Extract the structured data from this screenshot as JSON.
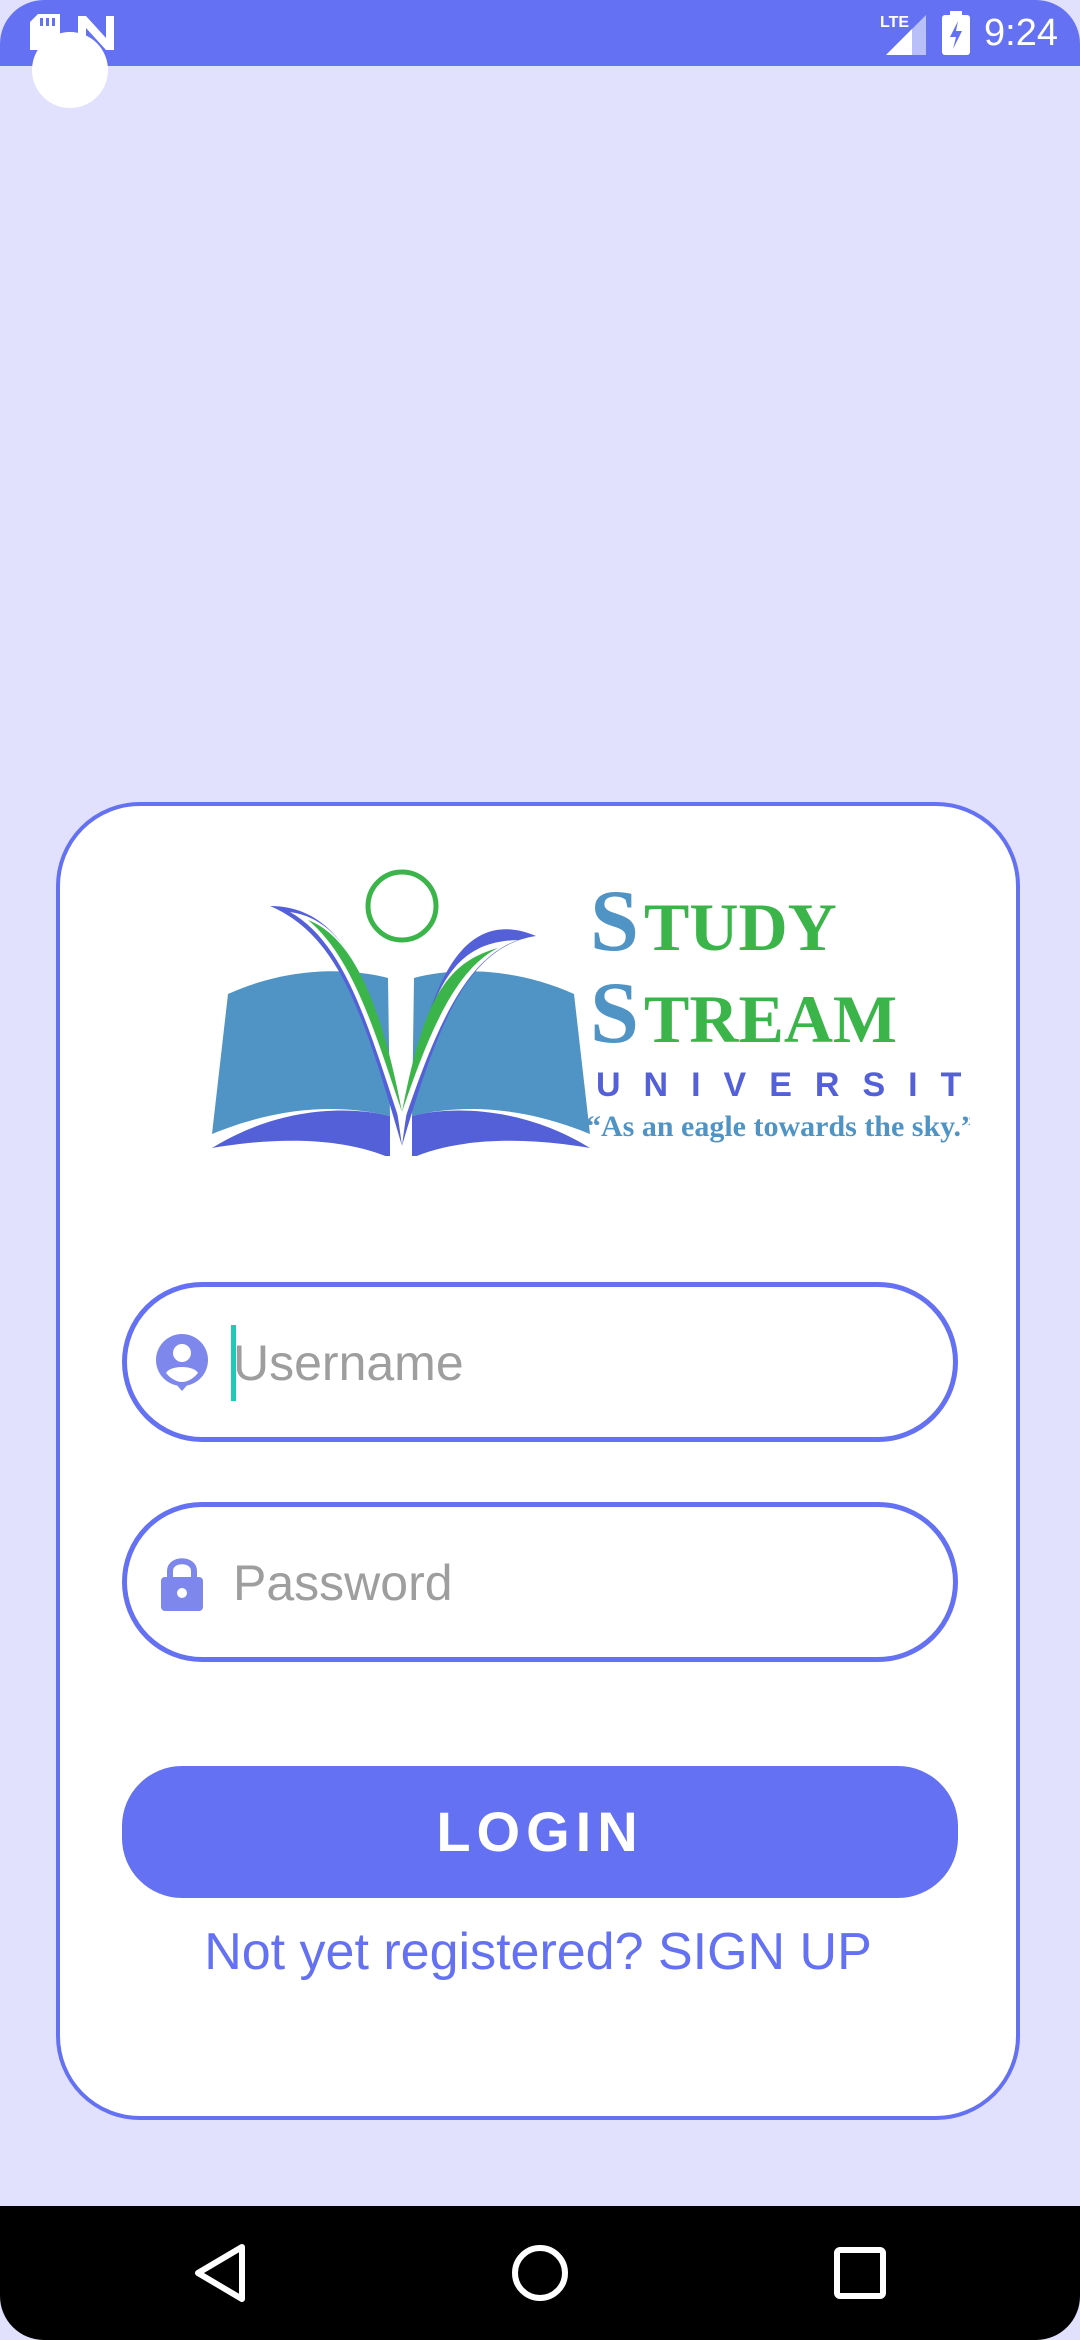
{
  "status_bar": {
    "time": "9:24",
    "network": "LTE",
    "left_icons": [
      "sd-card-icon",
      "n-notification-icon"
    ],
    "right_icons": [
      "lte-signal-icon",
      "battery-charging-icon"
    ]
  },
  "logo": {
    "title_line1": "STUDY",
    "title_line2": "STREAM",
    "subtitle": "UNIVERSITY",
    "tagline": "“As an eagle towards the sky.”"
  },
  "form": {
    "username": {
      "placeholder": "Username",
      "value": "",
      "icon": "account-icon"
    },
    "password": {
      "placeholder": "Password",
      "value": "",
      "icon": "lock-icon"
    },
    "login_label": "LOGIN",
    "signup_text": "Not yet registered? SIGN UP"
  },
  "navigation": {
    "items": [
      "back-icon",
      "home-icon",
      "recents-icon"
    ]
  },
  "colors": {
    "accent": "#6371f2",
    "background": "#e1e1fe",
    "logo_blue": "#4f94c5",
    "logo_green": "#3bb54a",
    "logo_navy": "#5460d8"
  }
}
